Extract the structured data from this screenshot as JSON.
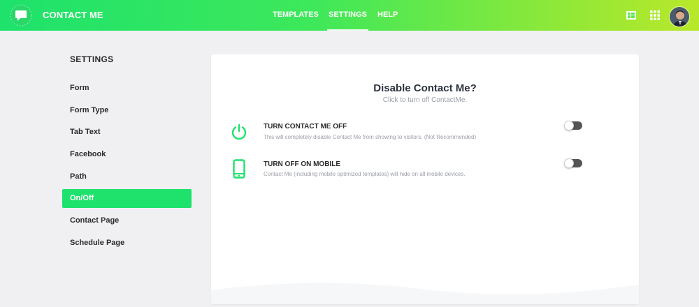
{
  "app": {
    "brand": "CONTACT ME"
  },
  "nav": {
    "items": [
      {
        "label": "TEMPLATES"
      },
      {
        "label": "SETTINGS"
      },
      {
        "label": "HELP"
      }
    ],
    "active": "SETTINGS"
  },
  "topbar_icons": [
    "dashboard-icon",
    "apps-grid-icon",
    "user-avatar"
  ],
  "sidebar": {
    "title": "SETTINGS",
    "items": [
      {
        "label": "Form"
      },
      {
        "label": "Form Type"
      },
      {
        "label": "Tab Text"
      },
      {
        "label": "Facebook"
      },
      {
        "label": "Path"
      },
      {
        "label": "On/Off"
      },
      {
        "label": "Contact Page"
      },
      {
        "label": "Schedule Page"
      }
    ],
    "active": "On/Off"
  },
  "panel": {
    "title": "Disable Contact Me?",
    "subtitle": "Click to turn off ContactMe.",
    "options": [
      {
        "icon": "power-icon",
        "title": "TURN CONTACT ME OFF",
        "description": "This will completely disable Contact Me from showing to visitors. (Not Recommended)",
        "enabled": false
      },
      {
        "icon": "mobile-phone-icon",
        "title": "TURN OFF ON MOBILE",
        "description": "Contact Me (including mobile optimized templates) will hide on all mobile devices.",
        "enabled": false
      }
    ]
  },
  "colors": {
    "accent": "#1ee26c",
    "gradient_end": "#b9e82a",
    "toggle_off": "#555555"
  }
}
